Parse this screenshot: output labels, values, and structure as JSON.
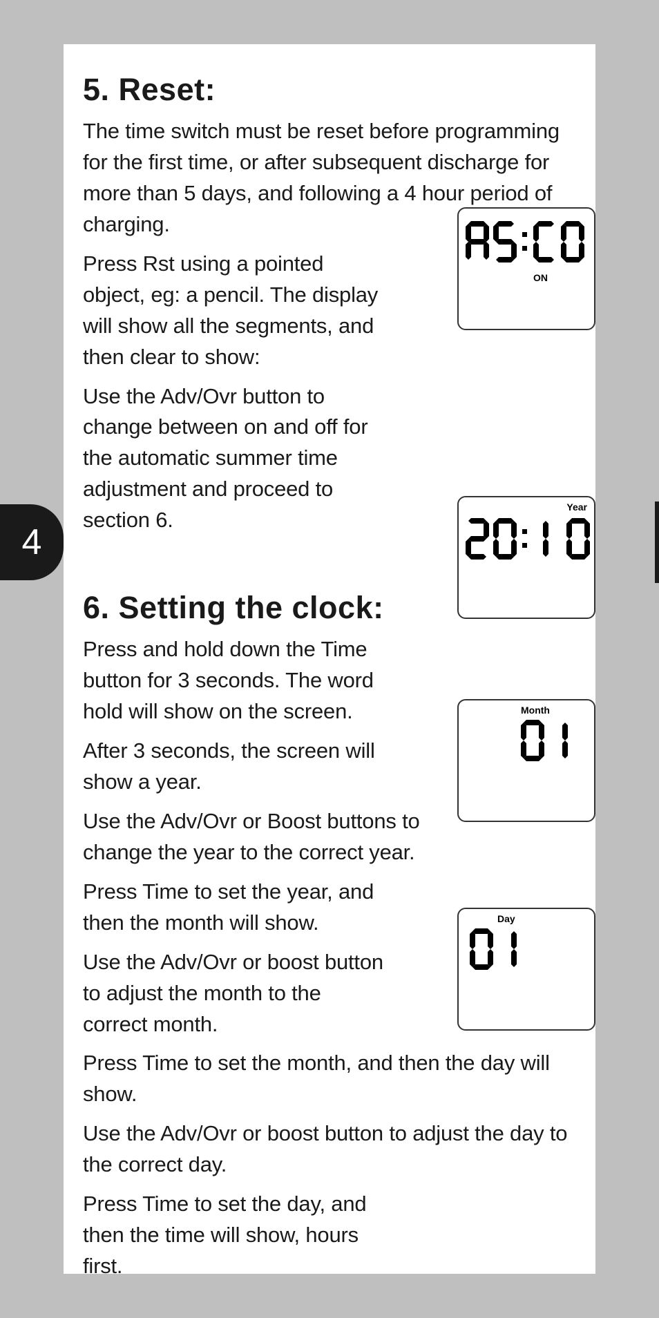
{
  "page_number": "4",
  "section5": {
    "heading": "5. Reset:",
    "p1": "The time switch must be reset before programming for the first time, or after subsequent discharge for more than 5 days, and following a 4 hour period of charging.",
    "p2": "Press Rst using a pointed object, eg: a pencil. The display will show all the segments, and then clear to show:",
    "p3": "Use the Adv/Ovr button to change between on and off for the automatic summer time adjustment and proceed to section 6."
  },
  "section6": {
    "heading": "6. Setting the clock:",
    "p1": "Press and hold down the Time button for 3 seconds. The word hold will show on the screen.",
    "p2": "After 3 seconds, the screen will show a year.",
    "p3": "Use the Adv/Ovr or Boost buttons to change the year to the correct year.",
    "p4": "Press Time to set the year, and then the month will show.",
    "p5": "Use the Adv/Ovr or boost button to adjust the month to the correct month.",
    "p6": "Press Time to set the month, and then the day will show.",
    "p7": "Use the Adv/Ovr or boost button to adjust the day to the correct day.",
    "p8": "Press Time to set the day, and then the time will show, hours first."
  },
  "lcd1": {
    "digits": "A5:C0",
    "annot": "ON"
  },
  "lcd2": {
    "digits": "20:1 0",
    "annot": "Year"
  },
  "lcd3": {
    "digits": "01",
    "annot": "Month"
  },
  "lcd4": {
    "digits": "01",
    "annot": "Day"
  }
}
